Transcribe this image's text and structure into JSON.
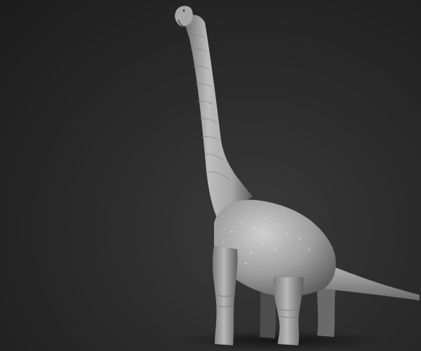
{
  "scene": {
    "subject": "sauropod-sculpt",
    "colors": {
      "background_center": "#3a3a3a",
      "background_edge": "#1c1c1c",
      "clay_light": "#c9c9c9",
      "clay_mid": "#9a9a9a",
      "clay_dark": "#5e5e5e",
      "shadow": "#141414"
    }
  }
}
